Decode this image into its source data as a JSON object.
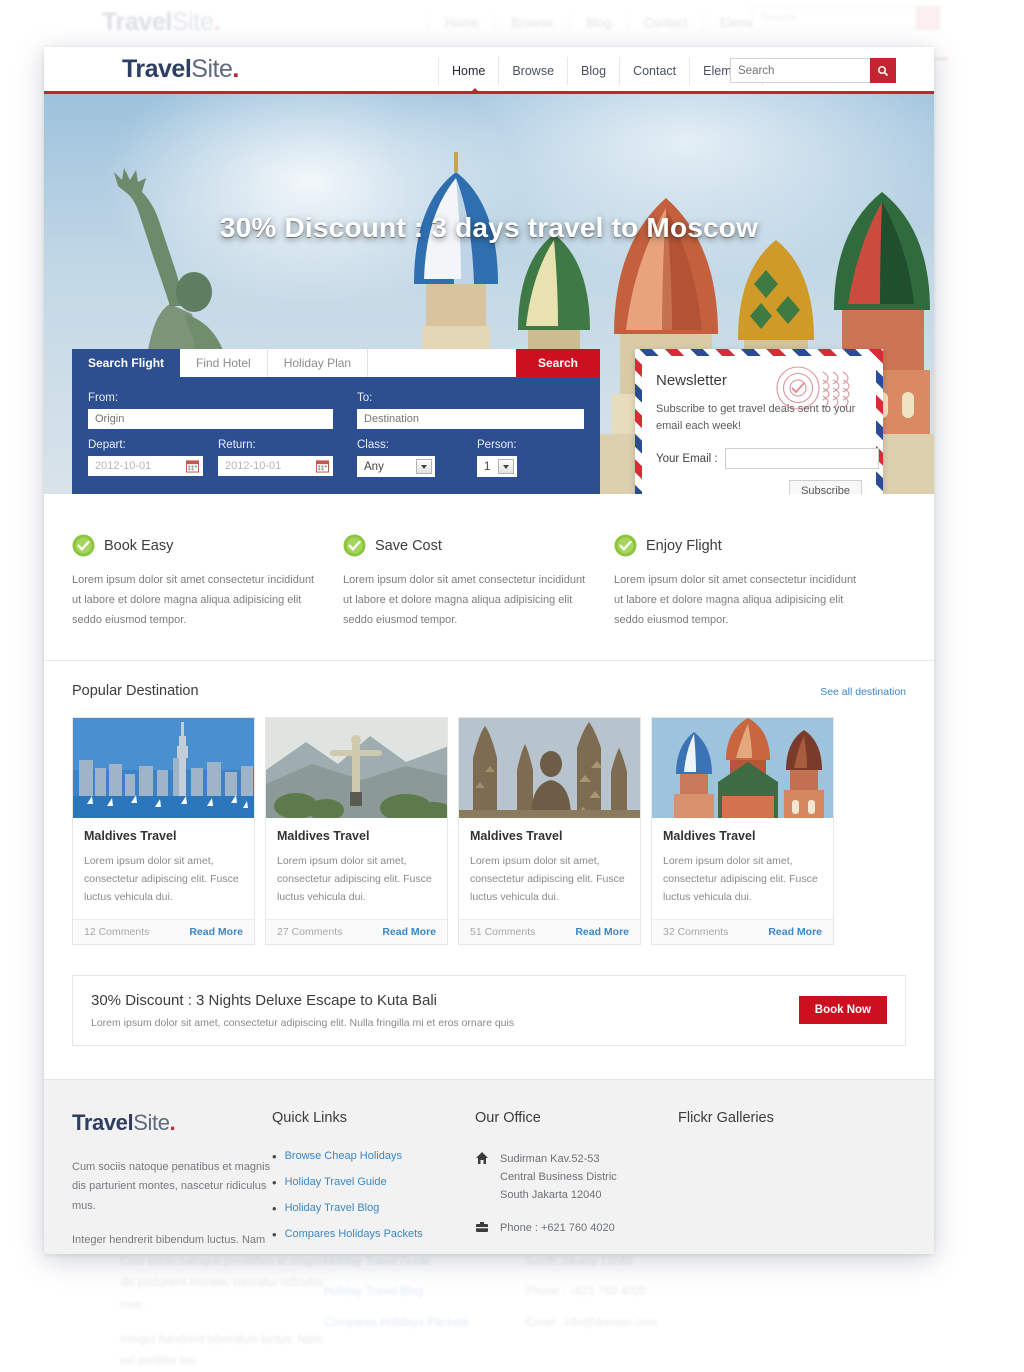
{
  "header": {
    "logo": {
      "bold": "Travel",
      "light": "Site",
      "dot": "."
    },
    "nav": [
      {
        "label": "Home",
        "active": true
      },
      {
        "label": "Browse",
        "active": false
      },
      {
        "label": "Blog",
        "active": false
      },
      {
        "label": "Contact",
        "active": false
      },
      {
        "label": "Element",
        "active": false
      }
    ],
    "search": {
      "placeholder": "Search",
      "icon": "search-icon"
    }
  },
  "hero": {
    "headline": "30% Discount : 3 days travel to Moscow",
    "image_alt": "Saint Basil's Cathedral, Moscow"
  },
  "booking": {
    "tabs": [
      {
        "label": "Search Flight",
        "active": true
      },
      {
        "label": "Find Hotel",
        "active": false
      },
      {
        "label": "Holiday Plan",
        "active": false
      }
    ],
    "search_button": "Search",
    "fields": {
      "from_label": "From:",
      "from_placeholder": "Origin",
      "to_label": "To:",
      "to_placeholder": "Destination",
      "depart_label": "Depart:",
      "depart_value": "2012-10-01",
      "return_label": "Return:",
      "return_value": "2012-10-01",
      "class_label": "Class:",
      "class_value": "Any",
      "person_label": "Person:",
      "person_value": "1"
    }
  },
  "newsletter": {
    "title": "Newsletter",
    "description": "Subscribe to get travel deals sent to your email each week!",
    "email_label": "Your Email :",
    "email_value": "",
    "subscribe_label": "Subscribe"
  },
  "features": [
    {
      "title": "Book Easy",
      "text": "Lorem ipsum dolor sit amet consectetur incididunt ut labore et dolore magna aliqua adipisicing elit seddo eiusmod tempor."
    },
    {
      "title": "Save Cost",
      "text": "Lorem ipsum dolor sit amet consectetur incididunt ut labore et dolore magna aliqua adipisicing elit seddo eiusmod tempor."
    },
    {
      "title": "Enjoy Flight",
      "text": "Lorem ipsum dolor sit amet consectetur incididunt ut labore et dolore magna aliqua adipisicing elit seddo eiusmod tempor."
    }
  ],
  "popular": {
    "title": "Popular Destination",
    "see_all": "See all destination",
    "cards": [
      {
        "title": "Maldives Travel",
        "text": "Lorem ipsum dolor sit amet, consectetur adipiscing elit. Fusce luctus vehicula dui.",
        "comments": "12 Comments",
        "read_more": "Read More",
        "image": "auckland-skyline"
      },
      {
        "title": "Maldives Travel",
        "text": "Lorem ipsum dolor sit amet, consectetur adipiscing elit. Fusce luctus vehicula dui.",
        "comments": "27 Comments",
        "read_more": "Read More",
        "image": "rio-christ-redeemer"
      },
      {
        "title": "Maldives Travel",
        "text": "Lorem ipsum dolor sit amet, consectetur adipiscing elit. Fusce luctus vehicula dui.",
        "comments": "51 Comments",
        "read_more": "Read More",
        "image": "borobudur-temple"
      },
      {
        "title": "Maldives Travel",
        "text": "Lorem ipsum dolor sit amet, consectetur adipiscing elit. Fusce luctus vehicula dui.",
        "comments": "32 Comments",
        "read_more": "Read More",
        "image": "saint-basil-cathedral"
      }
    ]
  },
  "promo": {
    "heading": "30% Discount : 3 Nights Deluxe Escape to Kuta Bali",
    "text": "Lorem ipsum dolor sit amet, consectetur adipiscing elit. Nulla fringilla mi et eros ornare quis",
    "button": "Book Now"
  },
  "footer": {
    "logo": {
      "bold": "Travel",
      "light": "Site",
      "dot": "."
    },
    "about_1": "Cum sociis natoque penatibus et magnis dis parturient montes, nascetur ridiculus mus.",
    "about_2": "Integer hendrerit bibendum luctus. Nam vel porttitor leo",
    "quick_links_title": "Quick Links",
    "quick_links": [
      "Browse Cheap Holidays",
      "Holiday Travel Guide",
      "Holiday Travel Blog",
      "Compares Holidays Packets"
    ],
    "office_title": "Our Office",
    "office": [
      {
        "icon": "home-icon",
        "text": "Sudirman Kav.52-53\nCentral Business Distric\nSouth Jakarta 12040"
      },
      {
        "icon": "phone-icon",
        "text": "Phone : +621 760 4020"
      },
      {
        "icon": "envelope-icon",
        "text": "Email : info@domain.com"
      }
    ],
    "flickr_title": "Flickr Galleries"
  },
  "colors": {
    "brand_blue": "#2c3e63",
    "accent_red": "#c0262f",
    "form_blue": "#2d4f8f",
    "button_red": "#cc1020",
    "link_blue": "#3a87c8",
    "check_green": "#8cc63e",
    "footer_bg": "#f2f2f2"
  }
}
